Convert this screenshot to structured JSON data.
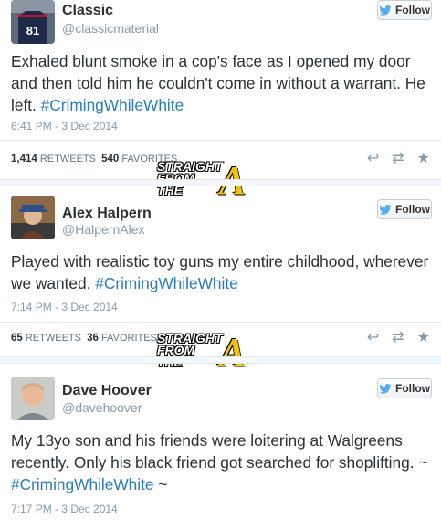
{
  "follow_label": "Follow",
  "watermark": {
    "line1": "STRAIGHT",
    "line2": "FROM",
    "line3": "THE",
    "letter": "A"
  },
  "tweets": [
    {
      "name": "Classic",
      "handle": "@classicmaterial",
      "text_before": "Exhaled blunt smoke in a cop's face as I opened my door and then told him he couldn't come in without a warrant. He left. ",
      "hashtag": "#CrimingWhileWhite",
      "text_after": "",
      "time": "6:41 PM - 3 Dec 2014",
      "retweets": "1,414",
      "retweets_label": "RETWEETS",
      "favorites": "540",
      "favorites_label": "FAVORITES"
    },
    {
      "name": "Alex Halpern",
      "handle": "@HalpernAlex",
      "text_before": "Played with realistic toy guns my entire childhood, wherever we wanted. ",
      "hashtag": "#CrimingWhileWhite",
      "text_after": "",
      "time": "7:14 PM - 3 Dec 2014",
      "retweets": "65",
      "retweets_label": "RETWEETS",
      "favorites": "36",
      "favorites_label": "FAVORITES"
    },
    {
      "name": "Dave Hoover",
      "handle": "@davehoover",
      "text_before": "My 13yo son and his friends were loitering at Walgreens recently. Only his black friend got searched for shoplifting. ~ ",
      "hashtag": "#CrimingWhileWhite",
      "text_after": " ~",
      "time": "7:17 PM - 3 Dec 2014"
    }
  ]
}
